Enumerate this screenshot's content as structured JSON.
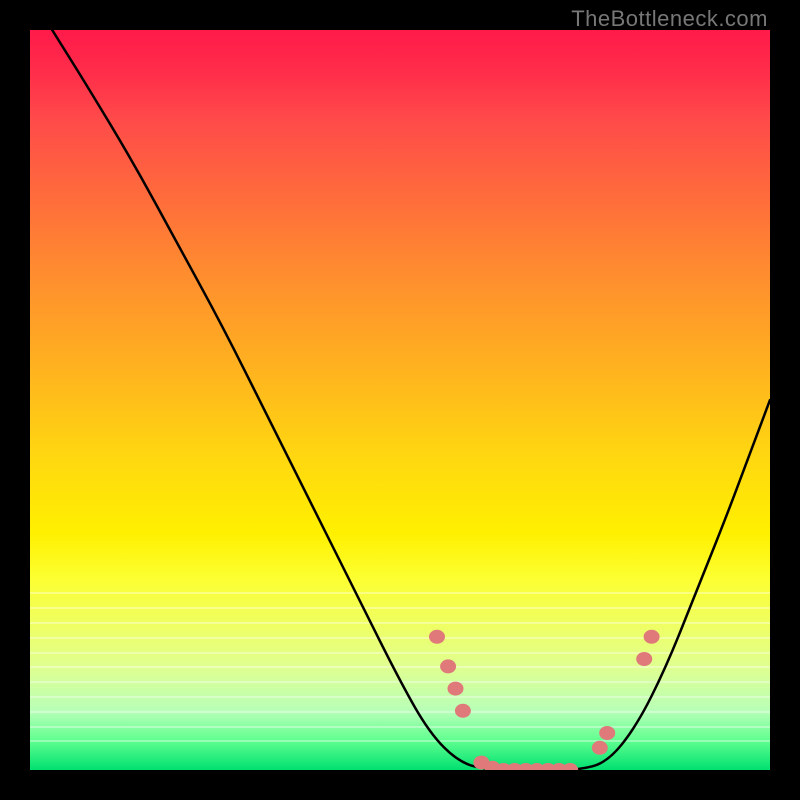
{
  "attribution": "TheBottleneck.com",
  "chart_data": {
    "type": "line",
    "title": "",
    "xlabel": "",
    "ylabel": "",
    "ylim": [
      0,
      100
    ],
    "xlim": [
      0,
      100
    ],
    "curve": {
      "name": "bottleneck-curve",
      "points": [
        {
          "x": 3,
          "y": 100
        },
        {
          "x": 8,
          "y": 92
        },
        {
          "x": 14,
          "y": 82
        },
        {
          "x": 20,
          "y": 71
        },
        {
          "x": 26,
          "y": 60
        },
        {
          "x": 32,
          "y": 48
        },
        {
          "x": 38,
          "y": 36
        },
        {
          "x": 44,
          "y": 24
        },
        {
          "x": 50,
          "y": 12
        },
        {
          "x": 54,
          "y": 5
        },
        {
          "x": 58,
          "y": 1
        },
        {
          "x": 62,
          "y": 0
        },
        {
          "x": 66,
          "y": 0
        },
        {
          "x": 70,
          "y": 0
        },
        {
          "x": 74,
          "y": 0
        },
        {
          "x": 78,
          "y": 1
        },
        {
          "x": 82,
          "y": 6
        },
        {
          "x": 86,
          "y": 14
        },
        {
          "x": 90,
          "y": 24
        },
        {
          "x": 94,
          "y": 34
        },
        {
          "x": 97,
          "y": 42
        },
        {
          "x": 100,
          "y": 50
        }
      ]
    },
    "markers": {
      "name": "highlight-points",
      "color": "#e07a7a",
      "points": [
        {
          "x": 55,
          "y": 18
        },
        {
          "x": 56.5,
          "y": 14
        },
        {
          "x": 57.5,
          "y": 11
        },
        {
          "x": 58.5,
          "y": 8
        },
        {
          "x": 61,
          "y": 1
        },
        {
          "x": 62.5,
          "y": 0.3
        },
        {
          "x": 64,
          "y": 0
        },
        {
          "x": 65.5,
          "y": 0
        },
        {
          "x": 67,
          "y": 0
        },
        {
          "x": 68.5,
          "y": 0
        },
        {
          "x": 70,
          "y": 0
        },
        {
          "x": 71.5,
          "y": 0
        },
        {
          "x": 73,
          "y": 0
        },
        {
          "x": 77,
          "y": 3
        },
        {
          "x": 78,
          "y": 5
        },
        {
          "x": 83,
          "y": 15
        },
        {
          "x": 84,
          "y": 18
        }
      ]
    },
    "gradient_colors": {
      "top": "#ff1a4a",
      "upper_mid": "#ffb020",
      "mid": "#fff000",
      "lower_mid": "#e0ff90",
      "bottom": "#00e070"
    }
  }
}
